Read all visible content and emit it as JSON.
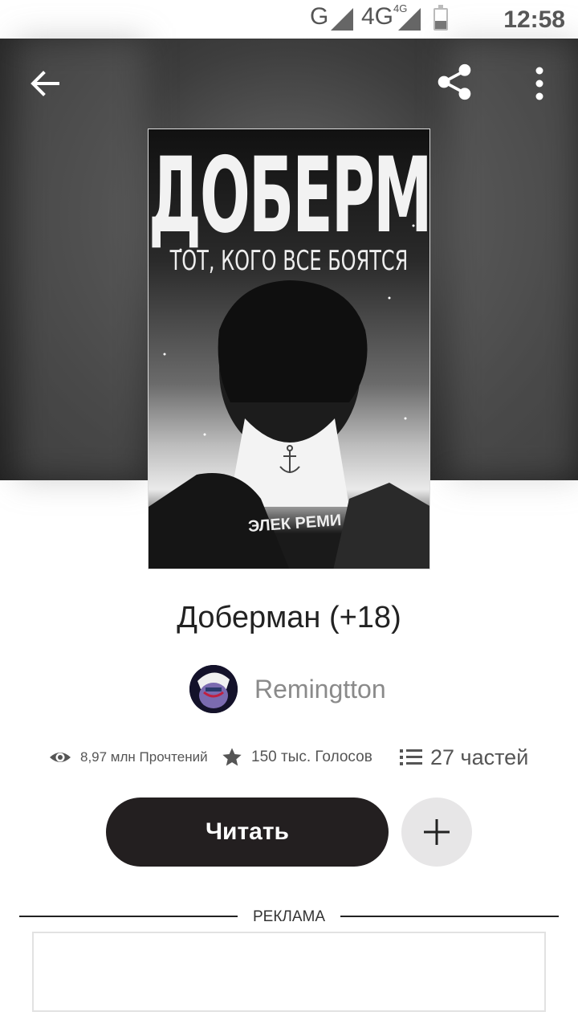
{
  "status_bar": {
    "network_1": "G",
    "network_2": "4G",
    "network_2_sup": "4G",
    "time": "12:58",
    "battery_level": 0.4
  },
  "toolbar": {
    "back_icon": "arrow-left-icon",
    "share_icon": "share-icon",
    "more_icon": "more-vertical-icon"
  },
  "cover": {
    "title": "ДОБЕРМАН",
    "subtitle": "ТОТ, КОГО ВСЕ БОЯТСЯ",
    "author": "ЭЛЕК РЕМИ"
  },
  "book": {
    "title": "Доберман (+18)",
    "author": "Remingtton"
  },
  "stats": {
    "reads": "8,97 млн Прочтений",
    "votes": "150 тыс. Голосов",
    "parts": "27 частей"
  },
  "actions": {
    "read_label": "Читать",
    "add_icon": "plus-icon"
  },
  "ad": {
    "label": "РЕКЛАМА"
  },
  "colors": {
    "primary_button": "#231f20",
    "secondary_button": "#e7e6e7",
    "muted_text": "#8a8a8a"
  }
}
